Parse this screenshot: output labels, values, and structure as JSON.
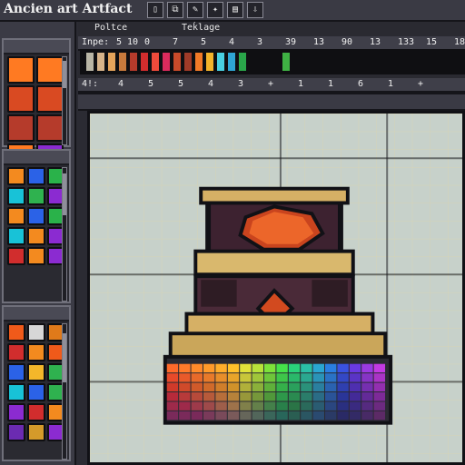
{
  "app": {
    "title": "Ancien art Artfact"
  },
  "toolbar": {
    "icons": [
      {
        "name": "page-icon",
        "glyph": "▯"
      },
      {
        "name": "mirror-icon",
        "glyph": "⧉"
      },
      {
        "name": "pencil-icon",
        "glyph": "✎"
      },
      {
        "name": "magic-wand-icon",
        "glyph": "✦"
      },
      {
        "name": "layers-icon",
        "glyph": "▤"
      },
      {
        "name": "export-icon",
        "glyph": "⇩"
      }
    ]
  },
  "labels": {
    "inputs_label": "Inpe:",
    "row1_numbers": [
      "5 10",
      "0",
      "7",
      "5",
      "4",
      "3",
      "39",
      "13",
      "90",
      "13",
      "133",
      "15",
      "18"
    ],
    "row2_numbers": [
      "4",
      "5",
      "5",
      "4",
      "3",
      "+",
      "1",
      "1",
      "6",
      "1",
      "+"
    ],
    "row2_prefix": "4!:",
    "polite": "Poltce",
    "teklage": "Teḱlage"
  },
  "palette": {
    "colors": [
      "#b9b6a6",
      "#d7b48a",
      "#e4a45b",
      "#c87a3c",
      "#b53b2b",
      "#d12d2d",
      "#ef4b3b",
      "#db2b5c",
      "#c84a2a",
      "#9f3b28",
      "#f27a27",
      "#f5b42a",
      "#49d0e1",
      "#2fa6d4",
      "#2aa64a",
      "#0f0f12",
      "#0f0f12",
      "#0f0f12",
      "#3fb244",
      "#0f0f12",
      "#0f0f12",
      "#0f0f12",
      "#0f0f12",
      "#0f0f12",
      "#0f0f12",
      "#0f0f12",
      "#0f0f12",
      "#0f0f12",
      "#0f0f12",
      "#0f0f12",
      "#0f0f12",
      "#0f0f12",
      "#0f0f12"
    ]
  },
  "sidebar": {
    "top_tiles": [
      {
        "name": "tile-rune-1",
        "color": "#ff7a22"
      },
      {
        "name": "tile-rune-2",
        "color": "#ff7a22"
      },
      {
        "name": "tile-rune-3",
        "color": "#d94a22"
      },
      {
        "name": "tile-rune-4",
        "color": "#d94a22"
      },
      {
        "name": "tile-rune-5",
        "color": "#b53b2b"
      },
      {
        "name": "tile-rune-6",
        "color": "#b53b2b"
      },
      {
        "name": "tile-rune-7",
        "color": "#ff7a22"
      },
      {
        "name": "tile-rune-8",
        "color": "#8b2bd1"
      }
    ],
    "gems": [
      {
        "name": "gem-orange",
        "color": "#f38a1f"
      },
      {
        "name": "gem-blue",
        "color": "#2b62e7"
      },
      {
        "name": "gem-green",
        "color": "#2ab24a"
      },
      {
        "name": "gem-cyan",
        "color": "#18c2d7"
      },
      {
        "name": "gem-green-2",
        "color": "#2fb24f"
      },
      {
        "name": "gem-purple",
        "color": "#8b2bd1"
      },
      {
        "name": "gem-orange-2",
        "color": "#f38a1f"
      },
      {
        "name": "gem-blue-2",
        "color": "#2b62e7"
      },
      {
        "name": "gem-green-3",
        "color": "#2ab24a"
      },
      {
        "name": "gem-cyan-2",
        "color": "#18c2d7"
      },
      {
        "name": "gem-orange-3",
        "color": "#f38a1f"
      },
      {
        "name": "gem-purple-2",
        "color": "#8b2bd1"
      },
      {
        "name": "gem-red",
        "color": "#d12d2d"
      },
      {
        "name": "gem-orange-4",
        "color": "#f38a1f"
      },
      {
        "name": "gem-purple-3",
        "color": "#8b2bd1"
      }
    ],
    "bottom_tiles": [
      {
        "name": "tile-fire",
        "color": "#f05a1a"
      },
      {
        "name": "tile-skull",
        "color": "#d7d7d7"
      },
      {
        "name": "tile-amber",
        "color": "#e07a1a"
      },
      {
        "name": "tile-shard-red",
        "color": "#d12d2d"
      },
      {
        "name": "tile-shard-orange",
        "color": "#f38a1f"
      },
      {
        "name": "tile-shard-orange-2",
        "color": "#f05a1a"
      },
      {
        "name": "tile-sapphire",
        "color": "#2b62e7"
      },
      {
        "name": "tile-topaz",
        "color": "#f4b72a"
      },
      {
        "name": "tile-emerald",
        "color": "#2fb24f"
      },
      {
        "name": "tile-crystal",
        "color": "#18c2d7"
      },
      {
        "name": "tile-orb",
        "color": "#2b62e7"
      },
      {
        "name": "tile-emerald-2",
        "color": "#2fb24f"
      },
      {
        "name": "tile-amethyst",
        "color": "#8b2bd1"
      },
      {
        "name": "tile-ruby",
        "color": "#d12d2d"
      },
      {
        "name": "tile-amber-2",
        "color": "#f38a1f"
      },
      {
        "name": "tile-purple",
        "color": "#6b2bb1"
      },
      {
        "name": "tile-gold",
        "color": "#d49a2a"
      },
      {
        "name": "tile-purple-2",
        "color": "#8b2bd1"
      }
    ]
  }
}
